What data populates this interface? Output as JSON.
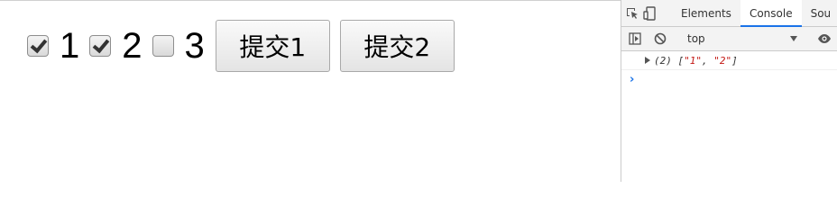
{
  "page": {
    "checkboxes": [
      {
        "label": "1",
        "checked": true
      },
      {
        "label": "2",
        "checked": true
      },
      {
        "label": "3",
        "checked": false
      }
    ],
    "buttons": [
      {
        "label": "提交1"
      },
      {
        "label": "提交2"
      }
    ]
  },
  "devtools": {
    "tabs": [
      {
        "label": "Elements",
        "active": false
      },
      {
        "label": "Console",
        "active": true
      },
      {
        "label": "Sou",
        "active": false
      }
    ],
    "toolbar": {
      "context": "top"
    },
    "console": {
      "entries": [
        {
          "prefix": "(2) [",
          "items": [
            "\"1\"",
            "\"2\""
          ],
          "suffix": "]"
        }
      ]
    },
    "icons": {
      "inspect": "inspect-element-icon",
      "device": "device-toggle-icon",
      "sidebar": "sidebar-toggle-icon",
      "clear": "clear-console-icon",
      "dropdown": "chevron-down-icon",
      "eye": "eye-icon",
      "expand": "expand-triangle-icon",
      "prompt": "prompt-icon"
    },
    "colors": {
      "accent": "#1a73e8",
      "string": "#c41a16"
    }
  }
}
